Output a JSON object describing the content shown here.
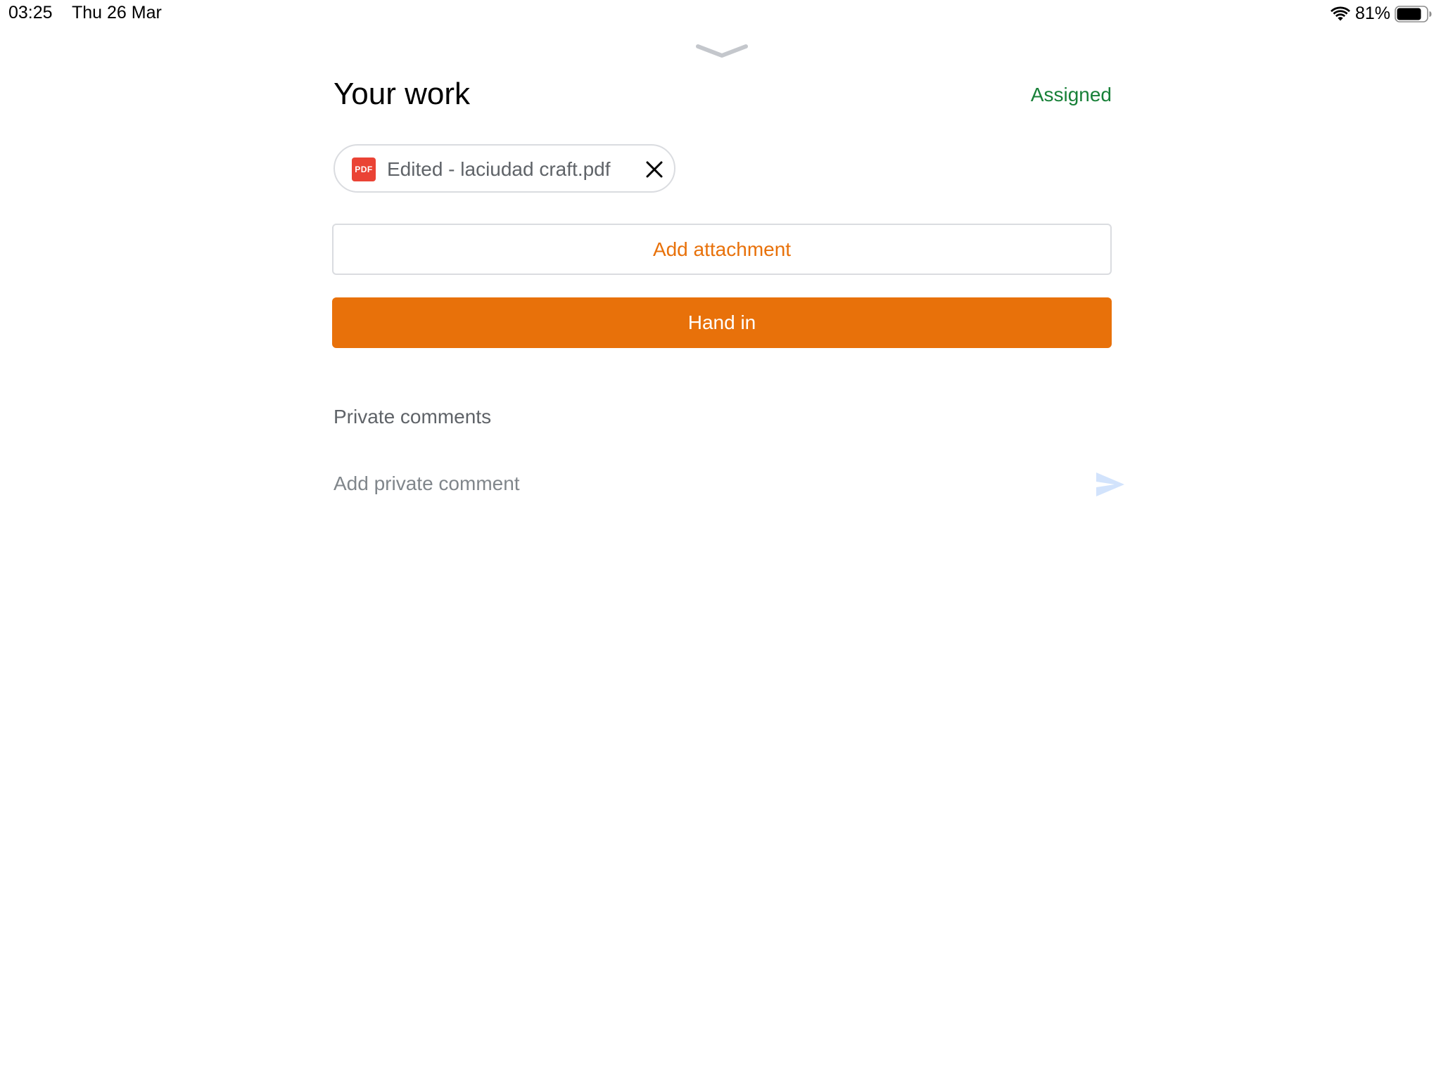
{
  "status_bar": {
    "time": "03:25",
    "date": "Thu 26 Mar",
    "battery_percent": "81%",
    "battery_level": 0.81,
    "icons": [
      "wifi-icon",
      "battery-icon"
    ]
  },
  "sheet": {
    "grabber_icon": "chevron-down-icon"
  },
  "header": {
    "title": "Your work",
    "status": "Assigned",
    "status_color": "#188038"
  },
  "attachment": {
    "icon": "pdf-icon",
    "icon_text": "PDF",
    "name": "Edited - laciudad craft.pdf",
    "remove_icon": "close-icon"
  },
  "buttons": {
    "add_attachment": "Add attachment",
    "hand_in": "Hand in"
  },
  "comments": {
    "heading": "Private comments",
    "placeholder": "Add private comment",
    "value": "",
    "send_icon": "send-icon"
  },
  "colors": {
    "accent": "#e8710a",
    "assigned_green": "#188038",
    "pdf_red": "#ea4335",
    "send_icon_disabled": "#d2e3fc",
    "border": "#dadce0"
  }
}
